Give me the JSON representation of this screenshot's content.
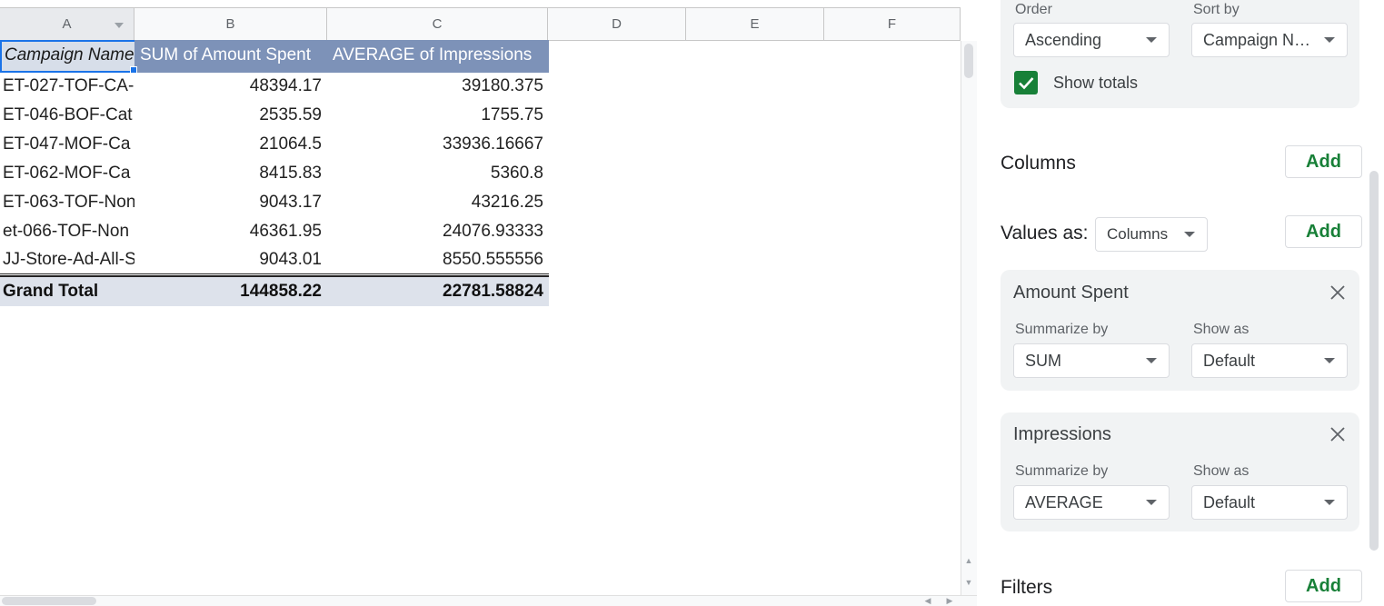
{
  "sheet": {
    "columns": [
      "A",
      "B",
      "C",
      "D",
      "E",
      "F"
    ],
    "header": {
      "row_label": "Campaign Name",
      "value1": "SUM of Amount Spent",
      "value2": "AVERAGE of Impressions"
    },
    "rows": [
      {
        "name": "ET-027-TOF-CA-",
        "spent": "48394.17",
        "impressions": "39180.375"
      },
      {
        "name": "ET-046-BOF-Cat",
        "spent": "2535.59",
        "impressions": "1755.75"
      },
      {
        "name": "ET-047-MOF-Ca",
        "spent": "21064.5",
        "impressions": "33936.16667"
      },
      {
        "name": "ET-062-MOF-Ca",
        "spent": "8415.83",
        "impressions": "5360.8"
      },
      {
        "name": "ET-063-TOF-Non",
        "spent": "9043.17",
        "impressions": "43216.25"
      },
      {
        "name": "et-066-TOF-Non",
        "spent": "46361.95",
        "impressions": "24076.93333"
      },
      {
        "name": "JJ-Store-Ad-All-S",
        "spent": "9043.01",
        "impressions": "8550.555556"
      }
    ],
    "total": {
      "label": "Grand Total",
      "spent": "144858.22",
      "impressions": "22781.58824"
    }
  },
  "panel": {
    "rows_sort": {
      "order_label": "Order",
      "order_value": "Ascending",
      "sortby_label": "Sort by",
      "sortby_value": "Campaign Name",
      "show_totals_label": "Show totals",
      "show_totals_checked": true
    },
    "columns_section": {
      "title": "Columns",
      "add_label": "Add"
    },
    "values_section": {
      "title": "Values as:",
      "values_as": "Columns",
      "add_label": "Add",
      "items": [
        {
          "title": "Amount Spent",
          "summarize_label": "Summarize by",
          "summarize_value": "SUM",
          "showas_label": "Show as",
          "showas_value": "Default"
        },
        {
          "title": "Impressions",
          "summarize_label": "Summarize by",
          "summarize_value": "AVERAGE",
          "showas_label": "Show as",
          "showas_value": "Default"
        }
      ]
    },
    "filters_section": {
      "title": "Filters",
      "add_label": "Add"
    }
  },
  "colors": {
    "pivot_header": "#7d92b8",
    "total_row": "#dde2eb",
    "accent_green": "#188038",
    "selection_blue": "#1a73e8"
  }
}
